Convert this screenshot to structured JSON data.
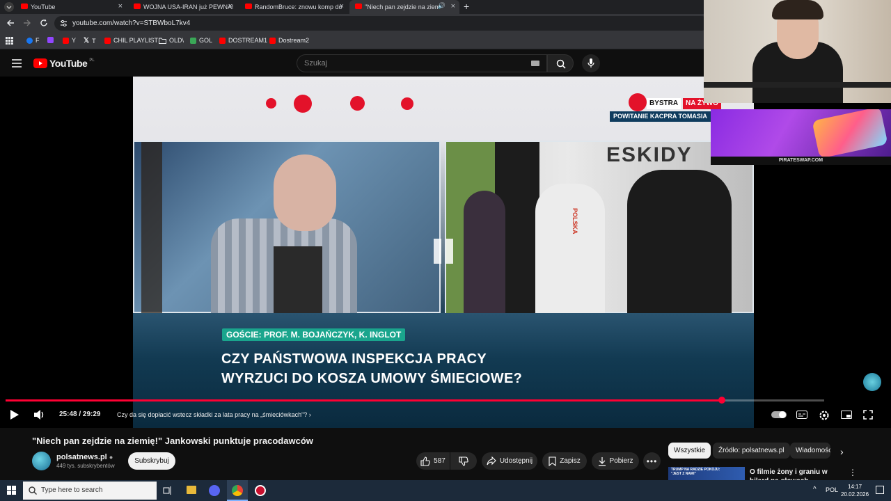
{
  "browser": {
    "tabs": [
      {
        "label": "YouTube",
        "active": false
      },
      {
        "label": "WOJNA USA-IRAN już PEWNA!",
        "active": false
      },
      {
        "label": "RandomBruce: znowu komp do",
        "active": false
      },
      {
        "label": "\"Niech pan zejdzie na ziemi",
        "active": true
      }
    ],
    "url": "youtube.com/watch?v=STBWboL7kv4",
    "bookmarks": [
      {
        "label": "F",
        "color": "#1877f2"
      },
      {
        "label": "",
        "color": "#9146ff"
      },
      {
        "label": "Y",
        "color": "#ff0000"
      },
      {
        "label": "T",
        "color": "#ffffff"
      },
      {
        "label": "CHIL PLAYLIST",
        "color": "#ff0000"
      },
      {
        "label": "OLD\\",
        "color": "#bbbbbb"
      },
      {
        "label": "GOL",
        "color": "#3aa757"
      },
      {
        "label": "DOSTREAM1",
        "color": "#ff0000"
      },
      {
        "label": "Dostream2",
        "color": "#ff0000"
      }
    ]
  },
  "youtube": {
    "logo_text": "YouTube",
    "logo_region": "PL",
    "search_placeholder": "Szukaj"
  },
  "video": {
    "overlay_brand": "BYSTRA",
    "overlay_live": "NA ŻYWO",
    "overlay_subtitle": "POWITANIE KACPRA TOMASIA",
    "banner_right_text": "ESKIDY",
    "guests_label": "GOŚCIE: PROF. M. BOJAŃCZYK, K. INGLOT",
    "headline_line1": "CZY PAŃSTWOWA INSPEKCJA PRACY",
    "headline_line2": "WYRZUCI DO KOSZA UMOWY ŚMIECIOWE?",
    "jacket_text": "POLSKA",
    "promo_url": "PIRATESWAP.COM"
  },
  "controls": {
    "current_time": "25:48",
    "duration": "29:29",
    "progress_fraction": 0.875,
    "chapter": "Czy da się dopłacić wstecz składki za lata pracy na „śmieciówkach\"?"
  },
  "info": {
    "title": "\"Niech pan zejdzie na ziemię!\" Jankowski punktuje pracodawców",
    "channel": "polsatnews.pl",
    "subscribers": "449 tys. subskrybentów",
    "subscribe_label": "Subskrybuj",
    "likes": "587",
    "share_label": "Udostępnij",
    "save_label": "Zapisz",
    "download_label": "Pobierz"
  },
  "sidebar": {
    "chips": [
      "Wszystkie",
      "Źródło: polsatnews.pl",
      "Wiadomości"
    ],
    "next_video_title": "O filmie żony i graniu w bilard na głowach. Najdziwniejsze",
    "next_thumb_text": "TRUMP NA RADZIE POKOJU: \"JEST Z NAMI\""
  },
  "taskbar": {
    "search_placeholder": "Type here to search",
    "language": "POL",
    "time": "14:17",
    "date": "20.02.2026"
  }
}
